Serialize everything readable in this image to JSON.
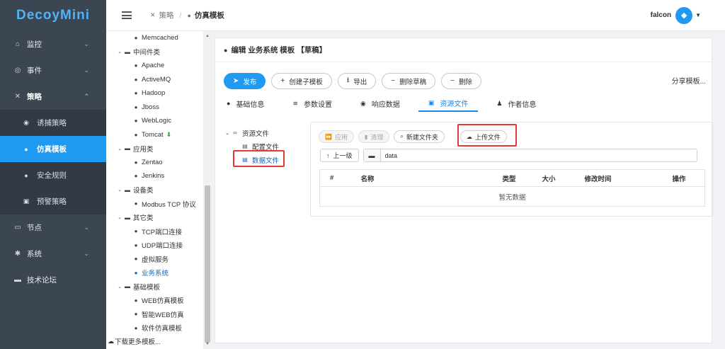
{
  "app": {
    "logo": "DecoyMini"
  },
  "sidebar": {
    "items": [
      {
        "label": "监控",
        "icon": "home-icon"
      },
      {
        "label": "事件",
        "icon": "target-icon"
      },
      {
        "label": "策略",
        "icon": "tools-icon"
      },
      {
        "label": "节点",
        "icon": "monitor-icon"
      },
      {
        "label": "系统",
        "icon": "gear-icon"
      },
      {
        "label": "技术论坛",
        "icon": "chat-icon"
      }
    ],
    "sub_items": [
      {
        "label": "诱捕策略",
        "icon": "eye-icon"
      },
      {
        "label": "仿真模板",
        "icon": "cube-icon"
      },
      {
        "label": "安全规则",
        "icon": "shield-icon"
      },
      {
        "label": "预警策略",
        "icon": "briefcase-icon"
      }
    ]
  },
  "header": {
    "crumb_1": "策略",
    "crumb_2": "仿真模板",
    "user": "falcon"
  },
  "tree": {
    "rows": [
      {
        "label": "Memcached",
        "level": 2
      },
      {
        "label": "中间件类",
        "level": 1
      },
      {
        "label": "Apache",
        "level": 2
      },
      {
        "label": "ActiveMQ",
        "level": 2
      },
      {
        "label": "Hadoop",
        "level": 2
      },
      {
        "label": "Jboss",
        "level": 2
      },
      {
        "label": "WebLogic",
        "level": 2
      },
      {
        "label": "Tomcat",
        "level": 2
      },
      {
        "label": "应用类",
        "level": 1
      },
      {
        "label": "Zentao",
        "level": 2
      },
      {
        "label": "Jenkins",
        "level": 2
      },
      {
        "label": "设备类",
        "level": 1
      },
      {
        "label": "Modbus TCP 协议",
        "level": 2
      },
      {
        "label": "其它类",
        "level": 1
      },
      {
        "label": "TCP端口连接",
        "level": 2
      },
      {
        "label": "UDP端口连接",
        "level": 2
      },
      {
        "label": "虚拟服务",
        "level": 2
      },
      {
        "label": "业务系统",
        "level": 2
      },
      {
        "label": "基础模板",
        "level": 1
      },
      {
        "label": "WEB仿真模板",
        "level": 2
      },
      {
        "label": "智能WEB仿真",
        "level": 2
      },
      {
        "label": "软件仿真模板",
        "level": 2
      }
    ],
    "download_more": "下载更多模板..."
  },
  "main": {
    "title": "编辑 业务系统 模板 【草稿】",
    "toolbar": {
      "publish": "发布",
      "create_child": "创建子模板",
      "export": "导出",
      "delete_draft": "删除草稿",
      "delete": "删除",
      "share": "分享模板..."
    },
    "tabs": [
      {
        "label": "基础信息"
      },
      {
        "label": "参数设置"
      },
      {
        "label": "响应数据"
      },
      {
        "label": "资源文件"
      },
      {
        "label": "作者信息"
      }
    ],
    "resource_tree": {
      "root": "资源文件",
      "config": "配置文件",
      "data": "数据文件"
    },
    "file_panel": {
      "apply": "应用",
      "clean": "清理",
      "new_folder": "新建文件夹",
      "upload": "上传文件",
      "up_level": "上一级",
      "path": "data",
      "columns": [
        "#",
        "名称",
        "类型",
        "大小",
        "修改时间",
        "操作"
      ],
      "empty": "暂无数据"
    }
  }
}
